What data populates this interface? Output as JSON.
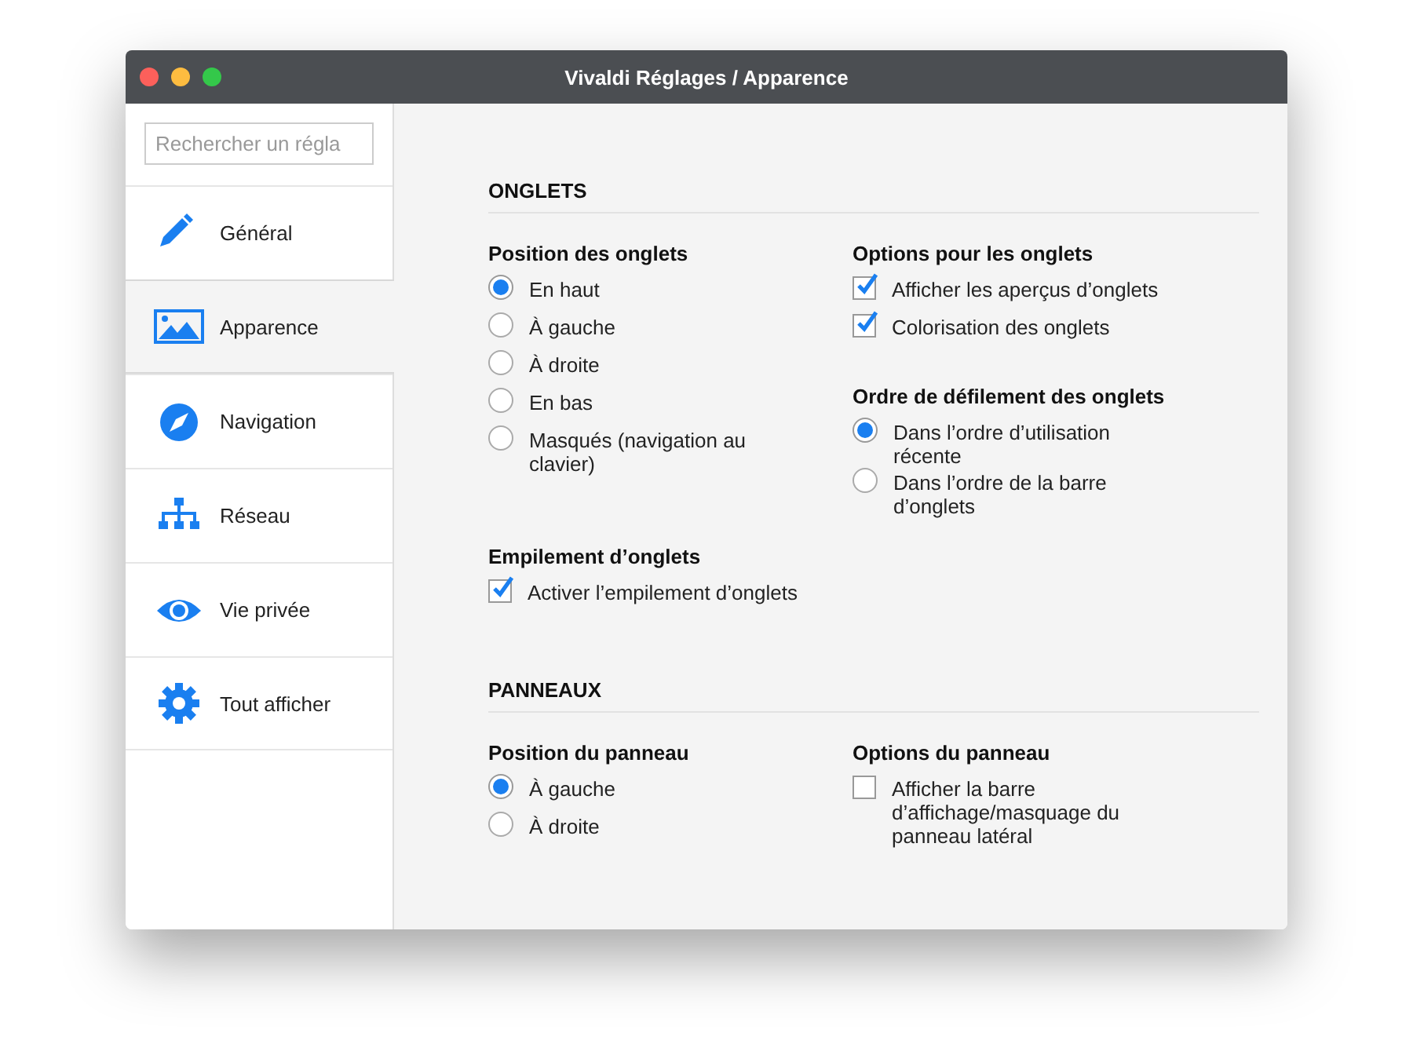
{
  "window": {
    "title": "Vivaldi Réglages / Apparence"
  },
  "sidebar": {
    "search": {
      "placeholder": "Rechercher un régla"
    },
    "items": [
      {
        "label": "Général",
        "selected": false
      },
      {
        "label": "Apparence",
        "selected": true
      },
      {
        "label": "Navigation",
        "selected": false
      },
      {
        "label": "Réseau",
        "selected": false
      },
      {
        "label": "Vie privée",
        "selected": false
      },
      {
        "label": "Tout afficher",
        "selected": false
      }
    ]
  },
  "sections": [
    {
      "title": "ONGLETS",
      "columns": [
        [
          {
            "heading": "Position des onglets",
            "options": [
              {
                "kind": "radio",
                "label": "En haut",
                "selected": true
              },
              {
                "kind": "radio",
                "label": "À gauche",
                "selected": false
              },
              {
                "kind": "radio",
                "label": "À droite",
                "selected": false
              },
              {
                "kind": "radio",
                "label": "En bas",
                "selected": false
              },
              {
                "kind": "radio",
                "label": "Masqués (navigation au clavier)",
                "selected": false
              }
            ]
          },
          {
            "heading": "Empilement d’onglets",
            "options": [
              {
                "kind": "checkbox",
                "label": "Activer l’empilement d’onglets",
                "checked": true
              }
            ]
          }
        ],
        [
          {
            "heading": "Options pour les onglets",
            "options": [
              {
                "kind": "checkbox",
                "label": "Afficher les aperçus d’onglets",
                "checked": true
              },
              {
                "kind": "checkbox",
                "label": "Colorisation des onglets",
                "checked": true
              }
            ]
          },
          {
            "heading": "Ordre de défilement des onglets",
            "options": [
              {
                "kind": "radio",
                "label": "Dans l’ordre d’utilisation récente",
                "selected": true
              },
              {
                "kind": "radio",
                "label": "Dans l’ordre de la barre d’onglets",
                "selected": false
              }
            ]
          }
        ]
      ]
    },
    {
      "title": "PANNEAUX",
      "columns": [
        [
          {
            "heading": "Position du panneau",
            "options": [
              {
                "kind": "radio",
                "label": "À gauche",
                "selected": true
              },
              {
                "kind": "radio",
                "label": "À droite",
                "selected": false
              }
            ]
          }
        ],
        [
          {
            "heading": "Options du panneau",
            "options": [
              {
                "kind": "checkbox",
                "label": "Afficher la barre d’affichage/masquage du panneau latéral",
                "checked": false
              }
            ]
          }
        ]
      ]
    }
  ]
}
